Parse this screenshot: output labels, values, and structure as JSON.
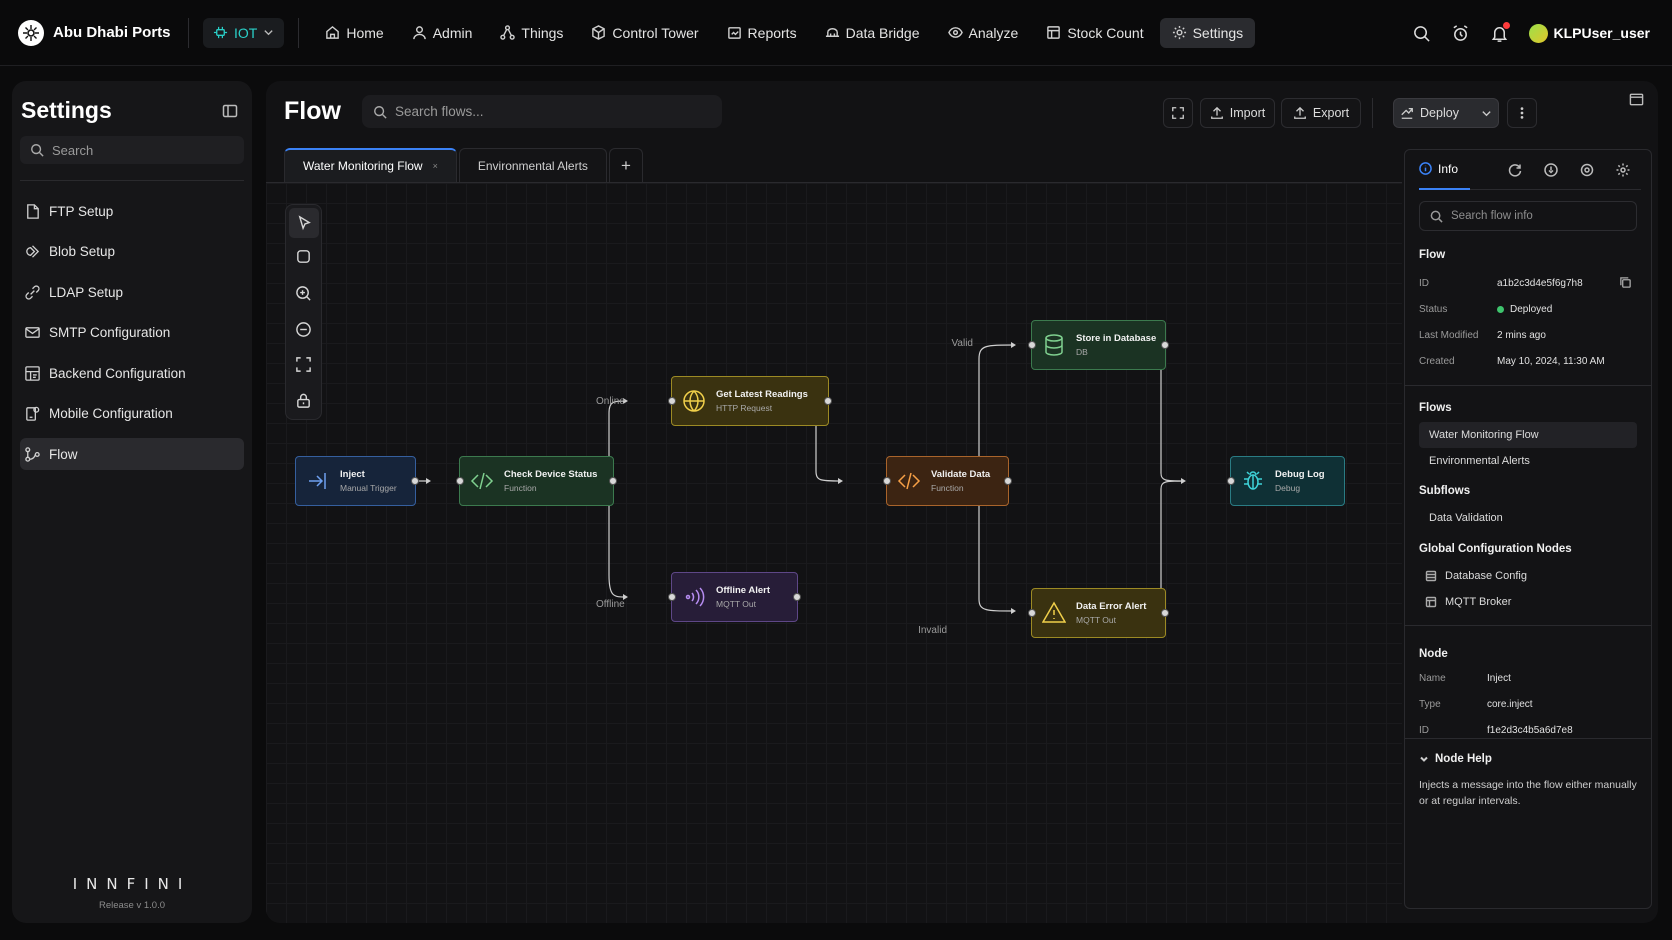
{
  "brand": {
    "name": "Abu Dhabi Ports"
  },
  "env_select": {
    "label": "IOT"
  },
  "nav": [
    {
      "label": "Home",
      "icon": "home-icon"
    },
    {
      "label": "Admin",
      "icon": "user-icon"
    },
    {
      "label": "Things",
      "icon": "things-icon"
    },
    {
      "label": "Control Tower",
      "icon": "tower-icon"
    },
    {
      "label": "Reports",
      "icon": "reports-icon"
    },
    {
      "label": "Data Bridge",
      "icon": "bridge-icon"
    },
    {
      "label": "Analyze",
      "icon": "analyze-icon"
    },
    {
      "label": "Stock Count",
      "icon": "stock-icon"
    },
    {
      "label": "Settings",
      "icon": "gear-icon",
      "active": true
    }
  ],
  "user": {
    "name": "KLPUser_user"
  },
  "sidebar": {
    "title": "Settings",
    "search_placeholder": "Search",
    "items": [
      {
        "label": "FTP Setup",
        "icon": "file-icon"
      },
      {
        "label": "Blob Setup",
        "icon": "blob-icon"
      },
      {
        "label": "LDAP Setup",
        "icon": "link-icon"
      },
      {
        "label": "SMTP Configuration",
        "icon": "mail-icon"
      },
      {
        "label": "Backend Configuration",
        "icon": "backend-icon"
      },
      {
        "label": "Mobile Configuration",
        "icon": "mobile-icon"
      },
      {
        "label": "Flow",
        "icon": "flow-icon",
        "active": true
      }
    ],
    "footer_logo": "INNFINI",
    "release": "Release v 1.0.0"
  },
  "main": {
    "title": "Flow",
    "search_placeholder": "Search flows...",
    "import_label": "Import",
    "export_label": "Export",
    "deploy_label": "Deploy"
  },
  "tabs": [
    {
      "label": "Water Monitoring Flow",
      "close": "×",
      "active": true
    },
    {
      "label": "Environmental Alerts"
    }
  ],
  "tab_add": "+",
  "flow_nodes": {
    "inject": {
      "title": "Inject",
      "type": "Manual Trigger"
    },
    "check": {
      "title": "Check Device Status",
      "type": "Function"
    },
    "readings": {
      "title": "Get Latest Readings",
      "type": "HTTP Request"
    },
    "offline": {
      "title": "Offline Alert",
      "type": "MQTT Out"
    },
    "validate": {
      "title": "Validate Data",
      "type": "Function"
    },
    "store": {
      "title": "Store in Database",
      "type": "DB"
    },
    "error": {
      "title": "Data Error Alert",
      "type": "MQTT Out"
    },
    "debug": {
      "title": "Debug Log",
      "type": "Debug"
    }
  },
  "edge_labels": {
    "online": "Online",
    "offline": "Offline",
    "valid": "Valid",
    "invalid": "Invalid"
  },
  "info_panel": {
    "tab_label": "Info",
    "search_placeholder": "Search flow info",
    "flow_heading": "Flow",
    "flow": {
      "id_label": "ID",
      "id": "a1b2c3d4e5f6g7h8",
      "status_label": "Status",
      "status": "Deployed",
      "modified_label": "Last Modified",
      "modified": "2 mins ago",
      "created_label": "Created",
      "created": "May 10, 2024, 11:30 AM"
    },
    "flows_heading": "Flows",
    "flows": [
      "Water Monitoring Flow",
      "Environmental Alerts"
    ],
    "subflows_heading": "Subflows",
    "subflows": [
      "Data Validation"
    ],
    "global_heading": "Global Configuration Nodes",
    "global_nodes": [
      "Database Config",
      "MQTT Broker"
    ],
    "node_heading": "Node",
    "node": {
      "name_label": "Name",
      "name": "Inject",
      "type_label": "Type",
      "type": "core.inject",
      "id_label": "ID",
      "id": "f1e2d3c4b5a6d7e8"
    },
    "help_heading": "Node Help",
    "help_text": "Injects a message into the flow either manually or at regular intervals."
  },
  "colors": {
    "accent": "#3b82f6",
    "status_ok": "#3ec46d",
    "brand_teal": "#2ad0c8"
  }
}
